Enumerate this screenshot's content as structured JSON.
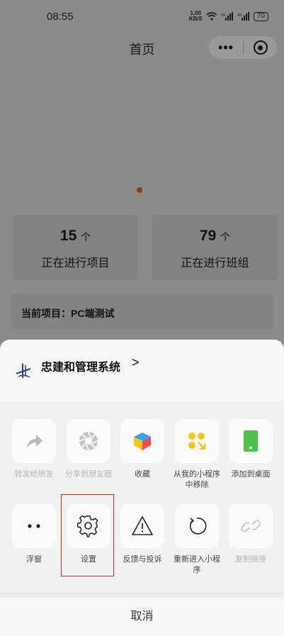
{
  "status_bar": {
    "time": "08:55",
    "net_speed_value": "1.00",
    "net_speed_unit": "KB/S",
    "battery": "70"
  },
  "nav": {
    "title": "首页",
    "more_label": "•••"
  },
  "stats": [
    {
      "value": "15",
      "unit": "个",
      "label": "正在进行项目"
    },
    {
      "value": "79",
      "unit": "个",
      "label": "正在进行班组"
    }
  ],
  "current_project": {
    "label": "当前项目：",
    "value": "PC端测试"
  },
  "sheet": {
    "app_name": "忠建和管理系统",
    "app_chevron": ">",
    "row1": [
      {
        "label": "转发给朋友",
        "icon": "share-arrow-icon",
        "disabled": true
      },
      {
        "label": "分享到朋友圈",
        "icon": "aperture-icon",
        "disabled": true
      },
      {
        "label": "收藏",
        "icon": "cube-icon",
        "disabled": false
      },
      {
        "label": "从我的小程序中移除",
        "icon": "remove-miniprogram-icon",
        "disabled": false
      },
      {
        "label": "添加到桌面",
        "icon": "add-to-desktop-icon",
        "disabled": false
      }
    ],
    "row2": [
      {
        "label": "浮窗",
        "icon": "float-window-icon",
        "disabled": false
      },
      {
        "label": "设置",
        "icon": "gear-icon",
        "disabled": false
      },
      {
        "label": "反馈与投诉",
        "icon": "warning-icon",
        "disabled": false
      },
      {
        "label": "重新进入小程序",
        "icon": "refresh-icon",
        "disabled": false
      },
      {
        "label": "复制链接",
        "icon": "link-icon",
        "disabled": true
      }
    ],
    "cancel_label": "取消"
  },
  "colors": {
    "overlay": "#8b8b8b",
    "sheet": "#f1f1f1",
    "highlight": "#c9252b",
    "favorite_yellow": "#f5c518",
    "desktop_green": "#4cc24a"
  }
}
